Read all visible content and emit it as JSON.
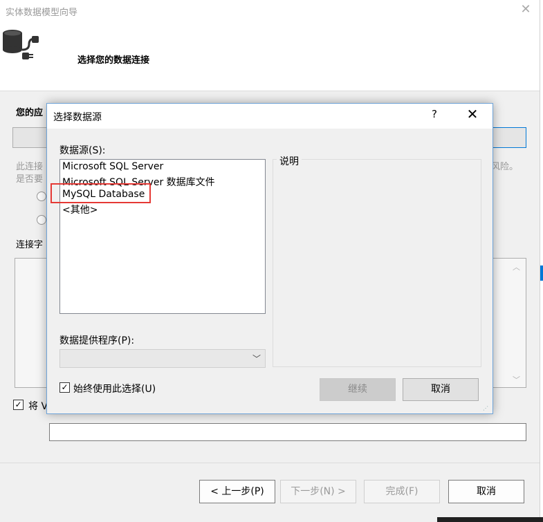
{
  "wizard": {
    "title": "实体数据模型向导",
    "subtitle": "选择您的数据连接",
    "question": "您的应",
    "desc_line1": "此连接",
    "desc_line2": "是否要",
    "desc_end": "风险。",
    "connstr_label": "连接字",
    "save_label": "将 V",
    "buttons": {
      "prev": "< 上一步(P)",
      "next": "下一步(N) >",
      "finish": "完成(F)",
      "cancel": "取消"
    },
    "save_checked": true
  },
  "dialog": {
    "title": "选择数据源",
    "help": "?",
    "close": "✕",
    "source_label": "数据源(S):",
    "sources": [
      "Microsoft SQL Server",
      "Microsoft SQL Server 数据库文件",
      "MySQL Database",
      "<其他>"
    ],
    "highlighted_source": "MySQL Database",
    "description_label": "说明",
    "provider_label": "数据提供程序(P):",
    "provider_value": "",
    "always_use_label": "始终使用此选择(U)",
    "always_use_checked": true,
    "continue_label": "继续",
    "cancel_label": "取消"
  },
  "colors": {
    "accent": "#0078d7",
    "highlight_box": "#e53935",
    "dialog_border": "#6ea3d8"
  }
}
